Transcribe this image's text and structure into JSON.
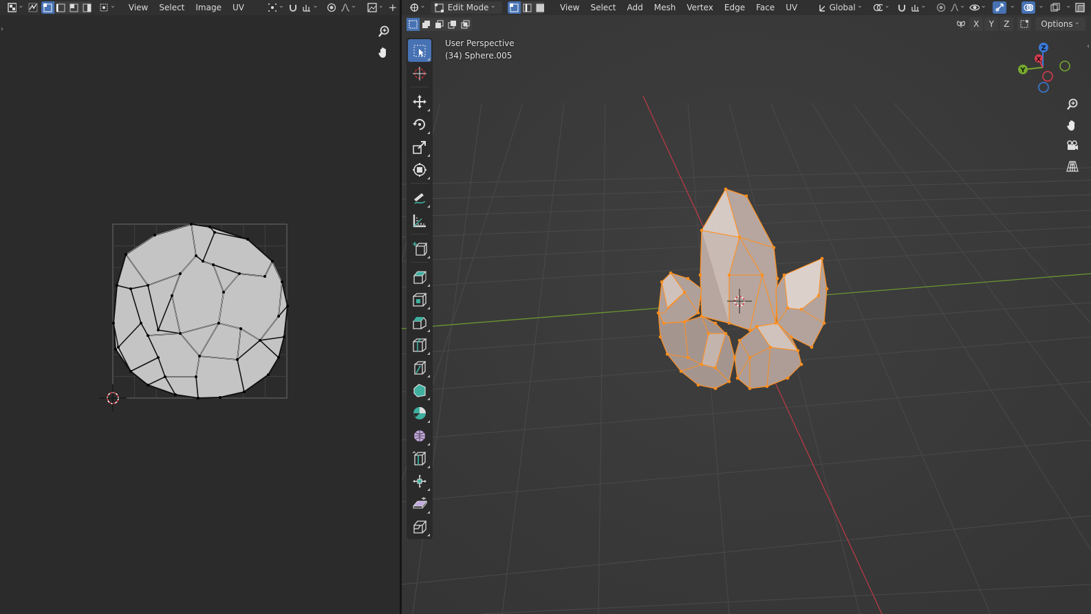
{
  "uv_header": {
    "menus": [
      "View",
      "Select",
      "Image",
      "UV"
    ]
  },
  "viewport_header": {
    "mode": "Edit Mode",
    "menus": [
      "View",
      "Select",
      "Add",
      "Mesh",
      "Vertex",
      "Edge",
      "Face",
      "UV"
    ],
    "orientation": "Global"
  },
  "viewport": {
    "perspective_label": "User Perspective",
    "object_label": "(34) Sphere.005",
    "options_label": "Options",
    "axis_labels": {
      "x": "X",
      "y": "Y",
      "z": "Z"
    }
  },
  "toolbar": {
    "tools": [
      "select-box-tool",
      "cursor-tool",
      "move-tool",
      "rotate-tool",
      "scale-tool",
      "transform-tool",
      "annotate-tool",
      "measure-tool",
      "add-cube-tool",
      "extrude-region-tool",
      "inset-faces-tool",
      "bevel-tool",
      "loop-cut-tool",
      "knife-tool",
      "poly-build-tool",
      "spin-tool",
      "smooth-tool",
      "edge-slide-tool",
      "shrink-fatten-tool",
      "shear-tool",
      "rip-region-tool"
    ]
  },
  "colors": {
    "accent": "#4772b3",
    "selection": "#ff8f1f",
    "x_axis": "#d63c4e",
    "y_axis": "#76a72f",
    "z_axis": "#3b7bd9"
  }
}
